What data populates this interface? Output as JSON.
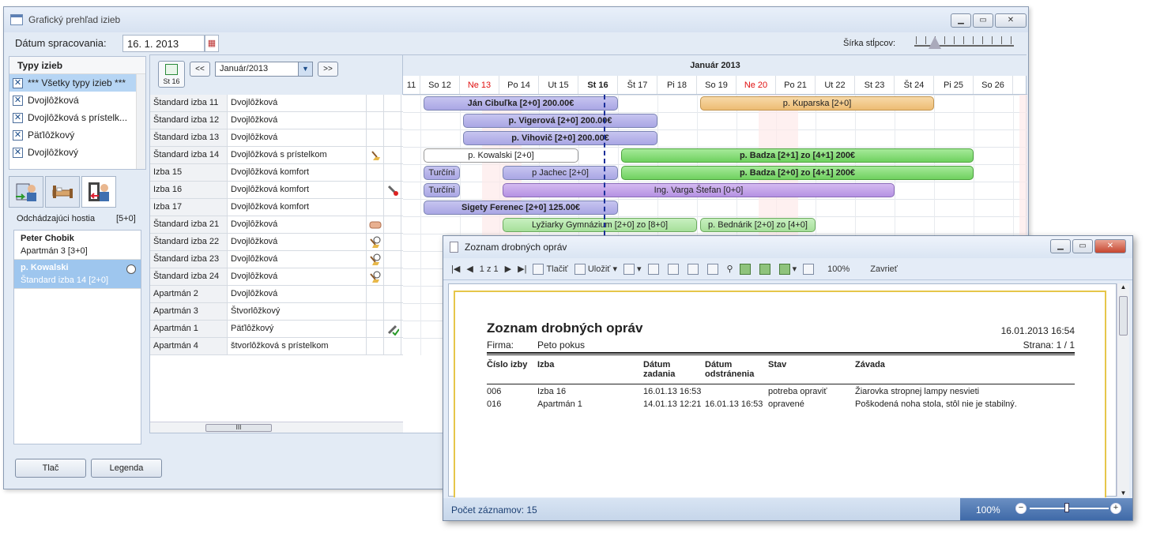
{
  "main_window": {
    "title": "Grafický prehľad izieb",
    "date_label": "Dátum spracovania:",
    "date_value": "16. 1. 2013",
    "col_width_label": "Šírka stĺpcov:"
  },
  "room_types": {
    "header": "Typy izieb",
    "items": [
      {
        "label": "*** Všetky typy izieb ***",
        "checked": true,
        "selected": true
      },
      {
        "label": "Dvojlôžková",
        "checked": true
      },
      {
        "label": "Dvojlôžková  s prístelk...",
        "checked": true
      },
      {
        "label": "Päťlôžkový",
        "checked": true
      },
      {
        "label": "Dvojlôžkový",
        "checked": true
      }
    ]
  },
  "guests": {
    "label": "Odchádzajúci hostia",
    "count": "[5+0]",
    "items": [
      {
        "name": "Peter Chobik",
        "room": "Apartmán 3 [3+0]"
      },
      {
        "name": "p. Kowalski",
        "room": "Štandard izba 14 [2+0]"
      }
    ]
  },
  "nav": {
    "today_label": "St 16",
    "prev": "<<",
    "next": ">>",
    "month": "Január/2013"
  },
  "calendar": {
    "month_header": "Január 2013",
    "days": [
      {
        "label": "11"
      },
      {
        "label": "So 12"
      },
      {
        "label": "Ne 13",
        "red": true
      },
      {
        "label": "Po 14"
      },
      {
        "label": "Ut 15"
      },
      {
        "label": "St 16",
        "bold": true
      },
      {
        "label": "Št 17"
      },
      {
        "label": "Pi 18"
      },
      {
        "label": "So 19"
      },
      {
        "label": "Ne 20",
        "red": true
      },
      {
        "label": "Po 21"
      },
      {
        "label": "Ut 22"
      },
      {
        "label": "St 23"
      },
      {
        "label": "Št 24"
      },
      {
        "label": "Pi 25"
      },
      {
        "label": "So 26"
      }
    ]
  },
  "rooms": [
    {
      "name": "Štandard izba 11",
      "type": "Dvojlôžková"
    },
    {
      "name": "Štandard izba 12",
      "type": "Dvojlôžková"
    },
    {
      "name": "Štandard izba 13",
      "type": "Dvojlôžková"
    },
    {
      "name": "Štandard izba 14",
      "type": "Dvojlôžková s prístelkom",
      "icon": "broom-icon"
    },
    {
      "name": "Izba 15",
      "type": "Dvojlôžková komfort"
    },
    {
      "name": "Izba 16",
      "type": "Dvojlôžková komfort",
      "icon2": "wrench-icon"
    },
    {
      "name": "Izba 17",
      "type": "Dvojlôžková komfort"
    },
    {
      "name": "Štandard izba 21",
      "type": "Dvojlôžková",
      "icon": "pillow-icon"
    },
    {
      "name": "Štandard izba 22",
      "type": "Dvojlôžková",
      "icon": "broom-clock-icon"
    },
    {
      "name": "Štandard izba 23",
      "type": "Dvojlôžková",
      "icon": "broom-clock-icon"
    },
    {
      "name": "Štandard izba 24",
      "type": "Dvojlôžková",
      "icon": "broom-clock-icon"
    },
    {
      "name": "Apartmán 2",
      "type": "Dvojlôžková"
    },
    {
      "name": "Apartmán 3",
      "type": "Štvorlôžkový"
    },
    {
      "name": "Apartmán 1",
      "type": "Päťlôžkový",
      "icon2": "repair-done-icon"
    },
    {
      "name": "Apartmán 4",
      "type": "štvorlôžková s prístelkom"
    }
  ],
  "bookings": [
    {
      "label": "Ján Cibuľka [2+0]  200.00€",
      "row": 0,
      "start": 1,
      "len": 5,
      "color": "purple",
      "bold": true
    },
    {
      "label": "p. Kuparska [2+0]",
      "row": 0,
      "start": 8,
      "len": 6,
      "color": "orange"
    },
    {
      "label": "p. Vigerová [2+0]  200.00€",
      "row": 1,
      "start": 2,
      "len": 5,
      "color": "purple",
      "bold": true
    },
    {
      "label": "p. Vihovič [2+0]  200.00€",
      "row": 2,
      "start": 2,
      "len": 5,
      "color": "purple",
      "bold": true
    },
    {
      "label": "p. Kowalski [2+0]",
      "row": 3,
      "start": 1,
      "len": 4,
      "color": "gray"
    },
    {
      "label": "p. Badza [2+1] zo [4+1]   200€",
      "row": 3,
      "start": 6,
      "len": 9,
      "color": "green"
    },
    {
      "label": "Turčíni",
      "row": 4,
      "start": 1,
      "len": 1,
      "color": "purple"
    },
    {
      "label": "p Jachec [2+0]",
      "row": 4,
      "start": 3,
      "len": 3,
      "color": "purple"
    },
    {
      "label": "p. Badza [2+0] zo [4+1]   200€",
      "row": 4,
      "start": 6,
      "len": 9,
      "color": "green"
    },
    {
      "label": "Turčíni",
      "row": 5,
      "start": 1,
      "len": 1,
      "color": "purple"
    },
    {
      "label": "Ing. Varga  Štefan [0+0]",
      "row": 5,
      "start": 3,
      "len": 10,
      "color": "violet"
    },
    {
      "label": "Sigety Ferenec [2+0]  125.00€",
      "row": 6,
      "start": 1,
      "len": 5,
      "color": "purple",
      "bold": true
    },
    {
      "label": "Lyžiarky Gymnázium [2+0] zo [8+0]",
      "row": 7,
      "start": 3,
      "len": 5,
      "color": "lgreen"
    },
    {
      "label": "p. Bednárik [2+0] zo [4+0]",
      "row": 7,
      "start": 8,
      "len": 3,
      "color": "lgreen"
    }
  ],
  "bottom_buttons": {
    "print": "Tlač",
    "legend": "Legenda"
  },
  "report_window": {
    "title": "Zoznam drobných opráv",
    "toolbar": {
      "page": "1 z 1",
      "print": "Tlačiť",
      "save": "Uložiť",
      "zoom": "100%",
      "close": "Zavrieť"
    },
    "report": {
      "heading": "Zoznam drobných opráv",
      "datetime": "16.01.2013 16:54",
      "firm_label": "Firma:",
      "firm_value": "Peto pokus",
      "page": "Strana: 1 / 1",
      "columns": [
        "Číslo izby",
        "Izba",
        "Dátum zadania",
        "Dátum odstránenia",
        "Stav",
        "Závada"
      ],
      "rows": [
        [
          "006",
          "Izba 16",
          "16.01.13 16:53",
          "",
          "potreba opraviť",
          "Žiarovka stropnej lampy nesvieti"
        ],
        [
          "016",
          "Apartmán 1",
          "14.01.13 12:21",
          "16.01.13 16:53",
          "opravené",
          "Poškodená noha stola, stôl nie je stabilný."
        ]
      ]
    },
    "status_count": "Počet záznamov: 15",
    "status_zoom": "100%"
  }
}
